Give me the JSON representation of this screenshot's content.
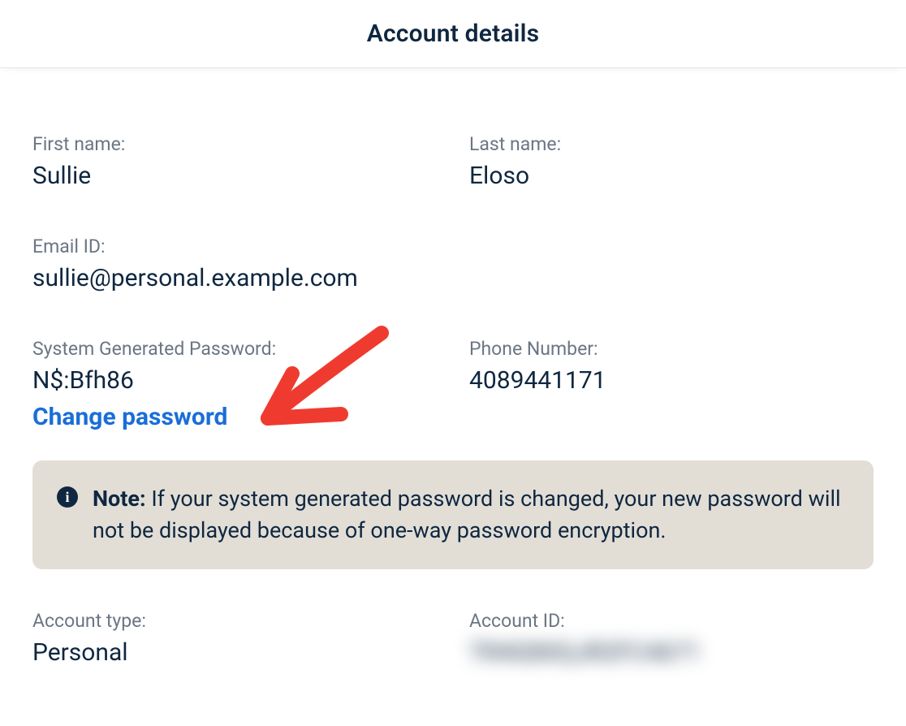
{
  "header": {
    "title": "Account details"
  },
  "fields": {
    "first_name": {
      "label": "First name:",
      "value": "Sullie"
    },
    "last_name": {
      "label": "Last name:",
      "value": "Eloso"
    },
    "email": {
      "label": "Email ID:",
      "value": "sullie@personal.example.com"
    },
    "sys_password": {
      "label": "System Generated Password:",
      "value": "N$:Bfh86"
    },
    "phone": {
      "label": "Phone Number:",
      "value": "4089441171"
    },
    "account_type": {
      "label": "Account type:",
      "value": "Personal"
    },
    "account_id": {
      "label": "Account ID:",
      "value": "TR4G8XQJR2FC4671"
    }
  },
  "actions": {
    "change_password": "Change password"
  },
  "note": {
    "prefix": "Note:",
    "body": " If your system generated password is changed, your new password will not be displayed because of one-way password encryption."
  },
  "icons": {
    "info": "i"
  }
}
